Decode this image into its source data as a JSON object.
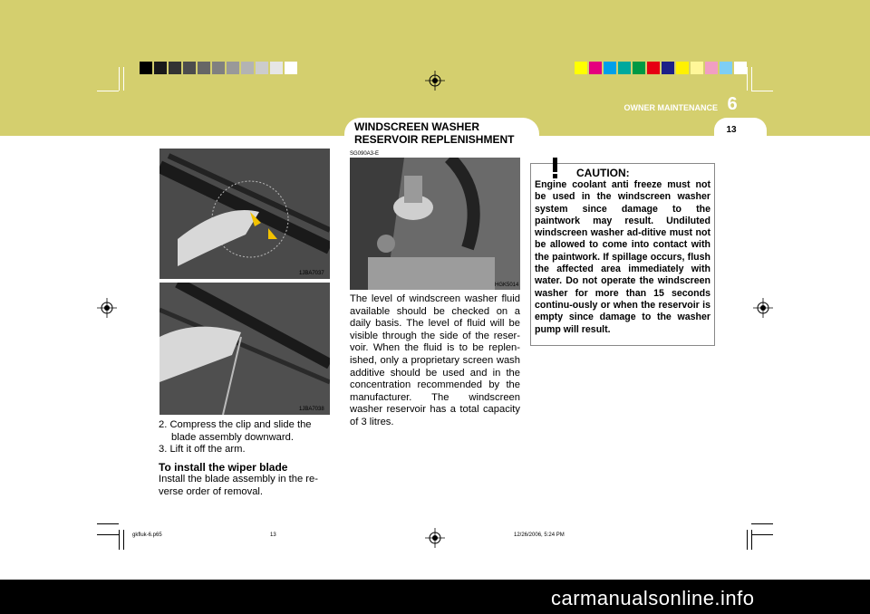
{
  "header": {
    "chapter_number": "6",
    "chapter_name": "OWNER MAINTENANCE",
    "page_number": "13"
  },
  "section": {
    "title": "WINDSCREEN  WASHER RESERVOIR  REPLENISHMENT",
    "code": "SG090A3-E"
  },
  "images": {
    "wiper_top_code": "1JBA7037",
    "wiper_bottom_code": "1JBA7038",
    "reservoir_code": "HGK5014"
  },
  "left_column": {
    "step2": "2. Compress the clip and slide the blade assembly downward.",
    "step3": "3. Lift it off the arm.",
    "install_heading": "To install the wiper blade",
    "install_text": "Install the blade assembly in the re-verse order of removal."
  },
  "middle_column": {
    "body": "The level of windscreen washer fluid available should be checked on a daily basis. The level of fluid will be visible through the side of the reser-voir. When the fluid is to be replen-ished, only a proprietary screen wash additive should be used and in the concentration recommended by the manufacturer. The windscreen washer reservoir has a total capacity of 3 litres."
  },
  "caution": {
    "title": "CAUTION:",
    "text": "Engine coolant anti freeze must not be used in the windscreen washer system since damage to the paintwork may result. Undiluted windscreen washer ad-ditive must not be allowed to come into contact with the paintwork. If spillage occurs, flush the affected area immediately with water. Do not operate the windscreen washer for more than 15 seconds continu-ously or when the reservoir is empty since damage to the washer pump will result."
  },
  "footer": {
    "file": "gkfluk-6.p65",
    "page": "13",
    "date": "12/26/2006, 5:24 PM"
  },
  "watermark": "carmanualsonline.info",
  "colors": {
    "page_bg": "#d4cf6e",
    "gray_bar": [
      "#000000",
      "#1a1a1a",
      "#333333",
      "#4d4d4d",
      "#666666",
      "#808080",
      "#999999",
      "#b3b3b3",
      "#cccccc",
      "#e6e6e6",
      "#ffffff"
    ],
    "color_bar": [
      "#ffff00",
      "#e5007e",
      "#00a0e9",
      "#00a99d",
      "#009944",
      "#e60012",
      "#1d2088",
      "#fff100",
      "#fff799",
      "#f19ec2",
      "#7ecef4",
      "#ffffff"
    ]
  }
}
